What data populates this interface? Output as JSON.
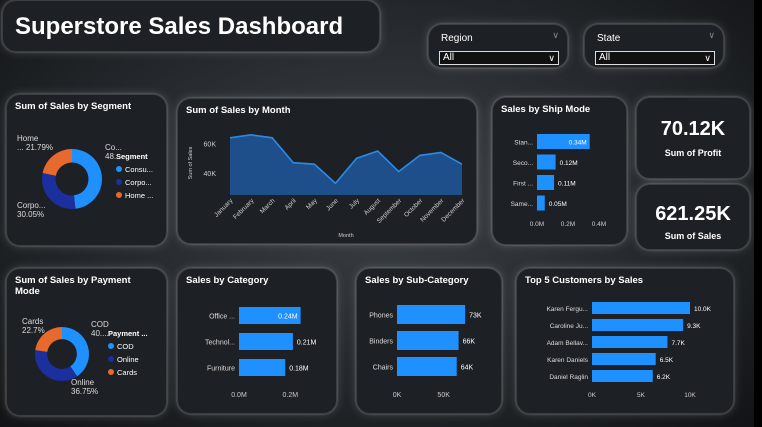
{
  "dashboard": {
    "title": "Superstore Sales Dashboard"
  },
  "filters": {
    "region": {
      "label": "Region",
      "value": "All"
    },
    "state": {
      "label": "State",
      "value": "All"
    }
  },
  "kpis": {
    "profit": {
      "value": "70.12K",
      "label": "Sum of Profit"
    },
    "sales": {
      "value": "621.25K",
      "label": "Sum of Sales"
    }
  },
  "colors": {
    "blue": "#1e90ff",
    "navy": "#1c2f9e",
    "orange": "#e8692d",
    "card": "#1d2024"
  },
  "segment": {
    "title": "Sum of Sales by Segment",
    "legend_title": "Segment",
    "chart_data": {
      "type": "pie",
      "labels": [
        "Consu...",
        "Corpo...",
        "Home ..."
      ],
      "slice_labels": [
        "Co... 48...",
        "Corpo... 30.05%",
        "Home ... 21.79%"
      ],
      "values": [
        48.16,
        30.05,
        21.79
      ],
      "colors": [
        "#1e90ff",
        "#1c2f9e",
        "#e8692d"
      ]
    }
  },
  "payment": {
    "title": "Sum of Sales by Payment Mode",
    "legend_title": "Payment ...",
    "chart_data": {
      "type": "pie",
      "labels": [
        "COD",
        "Online",
        "Cards"
      ],
      "slice_labels": [
        "COD 40....",
        "Online 36.75%",
        "Cards 22.7%"
      ],
      "values": [
        40.55,
        36.75,
        22.7
      ],
      "colors": [
        "#1e90ff",
        "#1c2f9e",
        "#e8692d"
      ]
    }
  },
  "month": {
    "title": "Sum of Sales by Month",
    "chart_data": {
      "type": "area",
      "x": [
        "January",
        "February",
        "March",
        "April",
        "May",
        "June",
        "July",
        "August",
        "September",
        "October",
        "November",
        "December"
      ],
      "values": [
        64000,
        66000,
        64000,
        47000,
        46000,
        33000,
        50000,
        55000,
        41000,
        52000,
        54000,
        46000
      ],
      "ylabel": "Sum of Sales",
      "xlabel": "Month",
      "yticks": [
        "60K",
        "40K"
      ],
      "ytick_values": [
        60000,
        40000
      ],
      "ylim": [
        25000,
        70000
      ]
    }
  },
  "ship": {
    "title": "Sales by Ship Mode",
    "chart_data": {
      "type": "bar",
      "categories": [
        "Stan...",
        "Seco...",
        "First ...",
        "Same..."
      ],
      "values": [
        0.34,
        0.12,
        0.11,
        0.05
      ],
      "data_labels": [
        "0.34M",
        "0.12M",
        "0.11M",
        "0.05M"
      ],
      "xticks": [
        "0.0M",
        "0.2M",
        "0.4M"
      ],
      "xtick_values": [
        0,
        0.2,
        0.4
      ],
      "xlim": [
        0,
        0.4
      ]
    }
  },
  "category": {
    "title": "Sales by Category",
    "chart_data": {
      "type": "bar",
      "categories": [
        "Office ...",
        "Technol...",
        "Furniture"
      ],
      "values": [
        0.24,
        0.21,
        0.18
      ],
      "data_labels": [
        "0.24M",
        "0.21M",
        "0.18M"
      ],
      "xticks": [
        "0.0M",
        "0.2M"
      ],
      "xtick_values": [
        0,
        0.2
      ],
      "xlim": [
        0,
        0.3
      ]
    }
  },
  "subcategory": {
    "title": "Sales by Sub-Category",
    "chart_data": {
      "type": "bar",
      "categories": [
        "Phones",
        "Binders",
        "Chairs"
      ],
      "values": [
        73,
        66,
        64
      ],
      "data_labels": [
        "73K",
        "66K",
        "64K"
      ],
      "xticks": [
        "0K",
        "50K"
      ],
      "xtick_values": [
        0,
        50
      ],
      "xlim": [
        0,
        90
      ]
    }
  },
  "customers": {
    "title": "Top 5 Customers by Sales",
    "chart_data": {
      "type": "bar",
      "categories": [
        "Karen Fergu...",
        "Caroline Ju...",
        "Adam Bellav...",
        "Karen Daniels",
        "Daniel Raglin"
      ],
      "values": [
        10.0,
        9.3,
        7.7,
        6.5,
        6.2
      ],
      "data_labels": [
        "10.0K",
        "9.3K",
        "7.7K",
        "6.5K",
        "6.2K"
      ],
      "xticks": [
        "0K",
        "5K",
        "10K"
      ],
      "xtick_values": [
        0,
        5,
        10
      ],
      "xlim": [
        0,
        10
      ]
    }
  }
}
